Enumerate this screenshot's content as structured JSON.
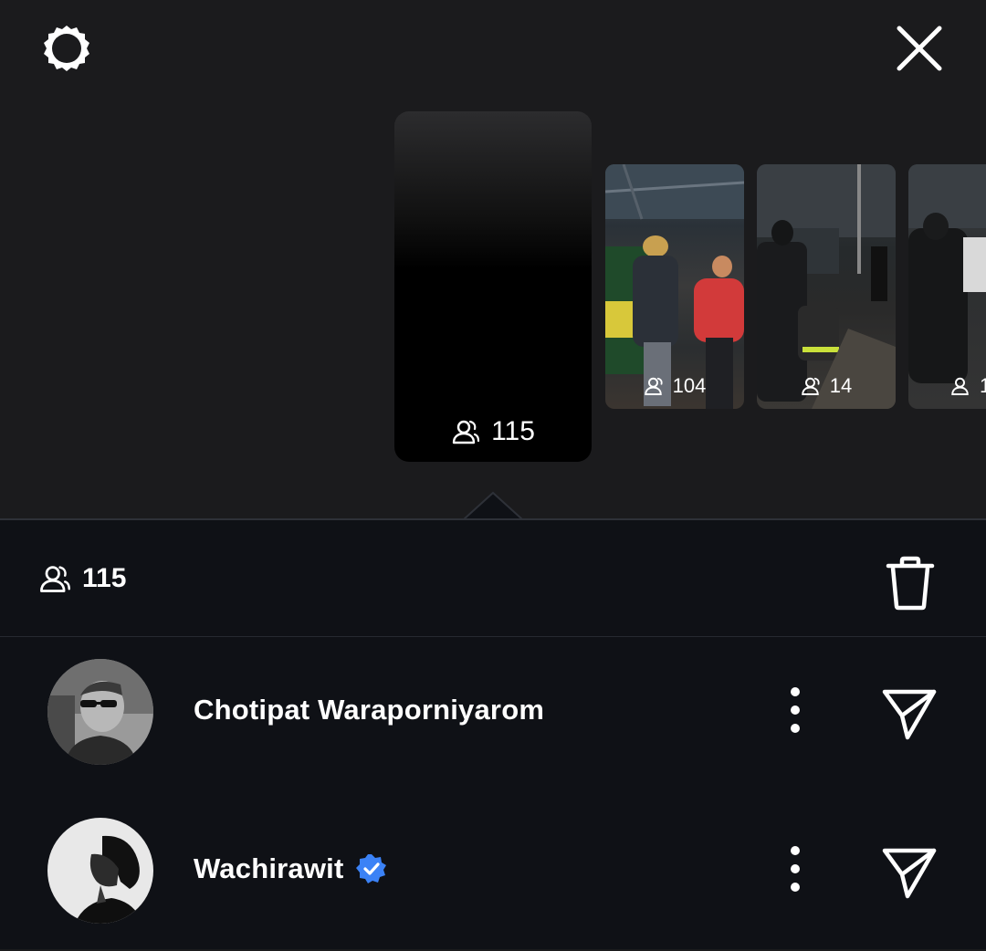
{
  "header": {
    "settings_icon": "gear-icon",
    "close_icon": "close-icon"
  },
  "stories": [
    {
      "id": "current",
      "views": "115"
    },
    {
      "id": "story-2",
      "views": "104"
    },
    {
      "id": "story-3",
      "views": "14"
    },
    {
      "id": "story-4",
      "views": "1"
    }
  ],
  "panel": {
    "viewer_count": "115",
    "delete_icon": "trash-icon"
  },
  "viewers": [
    {
      "name": "Chotipat Waraporniyarom",
      "verified": false
    },
    {
      "name": "Wachirawit",
      "verified": true
    }
  ],
  "colors": {
    "background_top": "#1b1b1d",
    "panel_background": "#0f1116",
    "verified_badge": "#3b82f6"
  }
}
